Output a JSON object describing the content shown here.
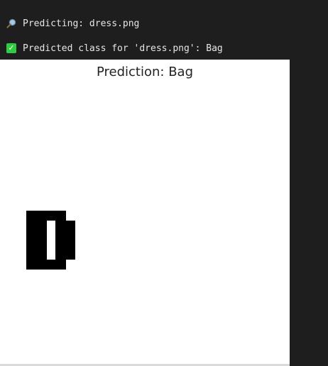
{
  "log": {
    "predicting_icon": "magnifier-icon",
    "predicting_text": "Predicting: dress.png",
    "result_icon": "check-mark-icon",
    "result_text": "Predicted class for 'dress.png': Bag"
  },
  "figure": {
    "title": "Prediction: Bag"
  },
  "colors": {
    "terminal_bg": "#1e1e1e",
    "terminal_text": "#e6e6e6",
    "figure_bg": "#ffffff",
    "check_green": "#2ecc40"
  }
}
